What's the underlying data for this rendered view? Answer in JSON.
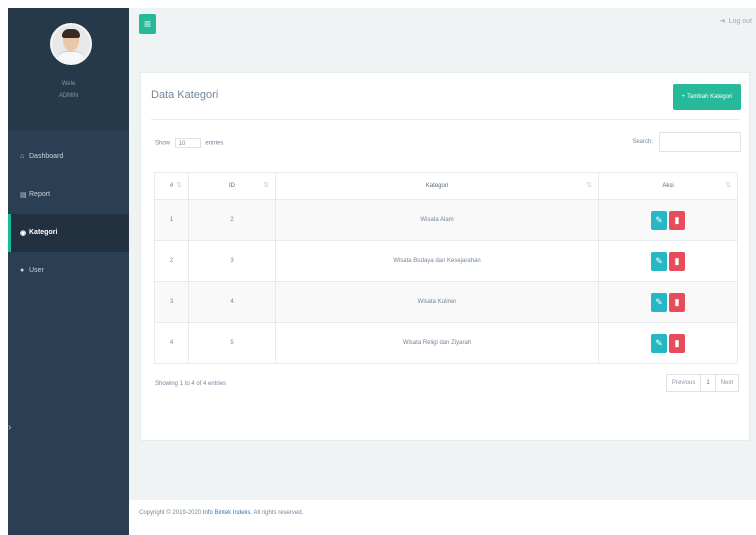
{
  "sidebar": {
    "greeting": "Wele",
    "user": "ADMIN",
    "items": [
      {
        "icon": "home-icon",
        "glyph": "⌂",
        "label": "Dashboard"
      },
      {
        "icon": "report-icon",
        "glyph": "▤",
        "label": "Report"
      },
      {
        "icon": "kategori-icon",
        "glyph": "◉",
        "label": "Kategori"
      },
      {
        "icon": "user-icon",
        "glyph": "●",
        "label": "User"
      }
    ],
    "active_index": 2,
    "collapse_glyph": "›"
  },
  "header": {
    "menu_glyph": "≡",
    "logout_glyph": "➜",
    "logout_label": "Log out"
  },
  "panel": {
    "title": "Data Kategori",
    "add_glyph": "+",
    "add_label": "Tambah Kategori",
    "show_label": "Show",
    "entries_value": "10",
    "entries_label": "entries",
    "search_label": "Search:",
    "columns": [
      "#",
      "ID",
      "Kategori",
      "Aksi"
    ],
    "rows": [
      {
        "no": "1",
        "id": "2",
        "kategori": "Wisata Alam"
      },
      {
        "no": "2",
        "id": "3",
        "kategori": "Wisata Budaya dan Kesejarahan"
      },
      {
        "no": "3",
        "id": "4",
        "kategori": "Wisata Kuliner"
      },
      {
        "no": "4",
        "id": "5",
        "kategori": "Wisata Religi dan Ziyarah"
      }
    ],
    "edit_glyph": "✎",
    "delete_glyph": "▮",
    "info": "Showing 1 to 4 of 4 entries",
    "pager": {
      "previous": "Previous",
      "current": "1",
      "next": "Next"
    }
  },
  "footer": {
    "copyright": "Copyright © 2019-2020",
    "link": "Info Bintek Indeks",
    "rights": ". All rights reserved."
  },
  "colors": {
    "sidebar": "#2a3f54",
    "accent": "#26b99a",
    "edit": "#26b7c5",
    "delete": "#e74c5a"
  }
}
